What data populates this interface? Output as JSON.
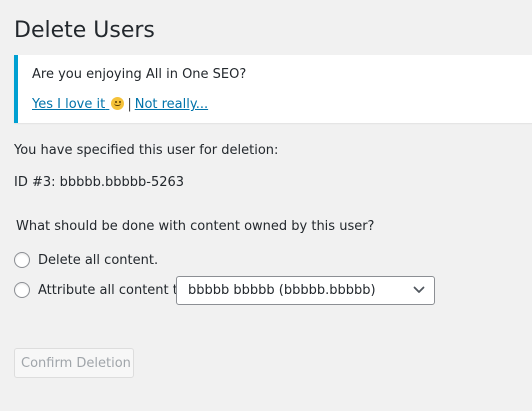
{
  "page": {
    "title": "Delete Users"
  },
  "notice": {
    "question": "Are you enjoying All in One SEO?",
    "yes_link": "Yes I love it",
    "separator": "|",
    "no_link": "Not really...",
    "accent_color": "#00a0d2"
  },
  "deletion": {
    "specified_text": "You have specified this user for deletion:",
    "user_line": "ID #3: bbbbb.bbbbb-5263",
    "question": "What should be done with content owned by this user?",
    "options": [
      {
        "label": "Delete all content.",
        "selected": false
      },
      {
        "label": "Attribute all content to:",
        "selected": false
      }
    ],
    "attribute_select": {
      "selected": "bbbbb bbbbb (bbbbb.bbbbb)"
    },
    "confirm_button": "Confirm Deletion"
  }
}
